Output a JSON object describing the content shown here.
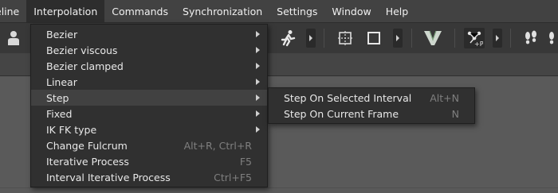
{
  "menubar": {
    "items": [
      "eline",
      "Interpolation",
      "Commands",
      "Synchronization",
      "Settings",
      "Window",
      "Help"
    ]
  },
  "icons": {
    "character": "person-icon",
    "running": "running-figure-icon",
    "frame_select": "dotted-square-icon",
    "square": "square-icon",
    "v_logo": "v-shape-icon",
    "node_p": "node-plus-p-icon",
    "footsteps": "footsteps-icon",
    "more": "triangle-right-icon"
  },
  "interpolation_menu": {
    "items": [
      {
        "label": "Bezier",
        "shortcut": "",
        "submenu": true
      },
      {
        "label": "Bezier viscous",
        "shortcut": "",
        "submenu": true
      },
      {
        "label": "Bezier clamped",
        "shortcut": "",
        "submenu": true
      },
      {
        "label": "Linear",
        "shortcut": "",
        "submenu": true
      },
      {
        "label": "Step",
        "shortcut": "",
        "submenu": true
      },
      {
        "label": "Fixed",
        "shortcut": "",
        "submenu": true
      },
      {
        "label": "IK FK type",
        "shortcut": "",
        "submenu": true
      },
      {
        "label": "Change Fulcrum",
        "shortcut": "Alt+R, Ctrl+R",
        "submenu": false
      },
      {
        "label": "Iterative Process",
        "shortcut": "F5",
        "submenu": false
      },
      {
        "label": "Interval Iterative Process",
        "shortcut": "Ctrl+F5",
        "submenu": false
      }
    ],
    "highlighted": "Step"
  },
  "step_submenu": {
    "items": [
      {
        "label": "Step On Selected Interval",
        "shortcut": "Alt+N"
      },
      {
        "label": "Step On Current Frame",
        "shortcut": "N"
      }
    ]
  },
  "colors": {
    "menubar_bg": "#424242",
    "menu_bg": "#303030",
    "highlight_bg": "#414141",
    "shortcut_text": "#7f7f7f"
  }
}
